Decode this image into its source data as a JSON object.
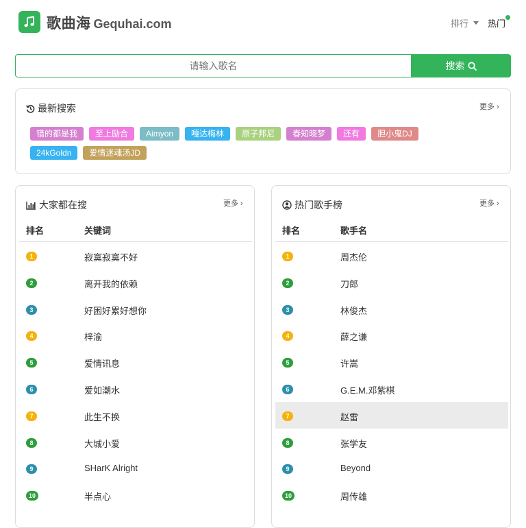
{
  "header": {
    "site_name": "歌曲海",
    "site_domain": "Gequhai.com",
    "nav_rank": "排行",
    "nav_hot": "热门",
    "accent": "#33b35a"
  },
  "search": {
    "placeholder": "请输入歌名",
    "button_label": "搜索"
  },
  "recent": {
    "title": "最新搜索",
    "more": "更多 ›",
    "tags": [
      {
        "label": "错的都是我",
        "color": "#d480cf"
      },
      {
        "label": "至上励合",
        "color": "#f07ae0"
      },
      {
        "label": "Aimyon",
        "color": "#7cbcc6"
      },
      {
        "label": "嘎达梅林",
        "color": "#36b3f0"
      },
      {
        "label": "原子邦尼",
        "color": "#a9d17e"
      },
      {
        "label": "春知晓梦",
        "color": "#d480cf"
      },
      {
        "label": "还有",
        "color": "#f07ae0"
      },
      {
        "label": "胆小鬼DJ",
        "color": "#e08989"
      },
      {
        "label": "24kGoldn",
        "color": "#36b3f0"
      },
      {
        "label": "爱情迷魂汤JD",
        "color": "#c2a15a"
      }
    ]
  },
  "popular": {
    "title": "大家都在搜",
    "more": "更多 ›",
    "col_rank": "排名",
    "col_name": "关键词",
    "rows": [
      {
        "rank": "1",
        "name": "寂寞寂寞不好"
      },
      {
        "rank": "2",
        "name": "离开我的依赖"
      },
      {
        "rank": "3",
        "name": "好困好累好想你"
      },
      {
        "rank": "4",
        "name": "梓渝"
      },
      {
        "rank": "5",
        "name": "爱情讯息"
      },
      {
        "rank": "6",
        "name": "爱如潮水"
      },
      {
        "rank": "7",
        "name": "此生不换"
      },
      {
        "rank": "8",
        "name": "大城小爱"
      },
      {
        "rank": "9",
        "name": "SHarK Alright"
      },
      {
        "rank": "10",
        "name": "半点心"
      }
    ]
  },
  "singers": {
    "title": "热门歌手榜",
    "more": "更多 ›",
    "col_rank": "排名",
    "col_name": "歌手名",
    "rows": [
      {
        "rank": "1",
        "name": "周杰伦"
      },
      {
        "rank": "2",
        "name": "刀郎"
      },
      {
        "rank": "3",
        "name": "林俊杰"
      },
      {
        "rank": "4",
        "name": "薛之谦"
      },
      {
        "rank": "5",
        "name": "许嵩"
      },
      {
        "rank": "6",
        "name": "G.E.M.邓紫棋"
      },
      {
        "rank": "7",
        "name": "赵雷"
      },
      {
        "rank": "8",
        "name": "张学友"
      },
      {
        "rank": "9",
        "name": "Beyond"
      },
      {
        "rank": "10",
        "name": "周传雄"
      }
    ],
    "highlighted_row": 7
  },
  "badge_colors": [
    "#f5b20a",
    "#2e9e3c",
    "#2e8fad",
    "#f5b20a",
    "#2e9e3c",
    "#2e8fad",
    "#f5b20a",
    "#2e9e3c",
    "#2e8fad",
    "#2e9e3c"
  ]
}
